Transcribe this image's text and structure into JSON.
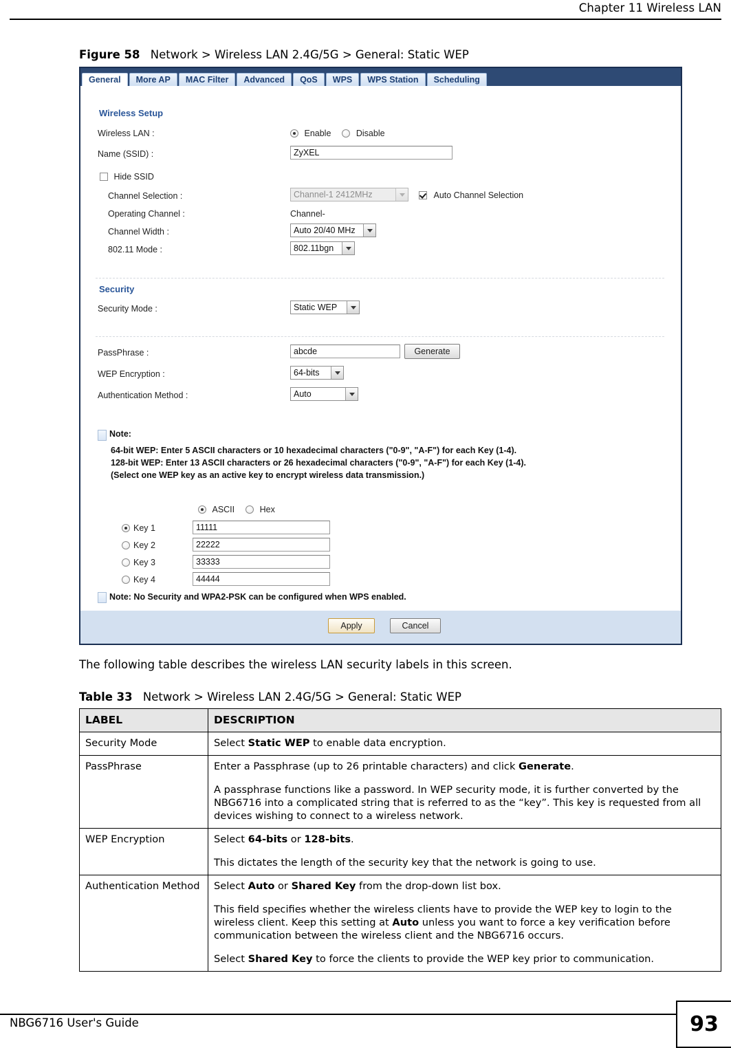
{
  "page": {
    "chapter_header": "Chapter 11 Wireless LAN",
    "footer_guide": "NBG6716 User's Guide",
    "page_number": "93"
  },
  "figure": {
    "label": "Figure 58",
    "title": "Network > Wireless LAN 2.4G/5G > General: Static WEP"
  },
  "screenshot": {
    "tabs": [
      {
        "label": "General",
        "active": true
      },
      {
        "label": "More AP",
        "active": false
      },
      {
        "label": "MAC Filter",
        "active": false
      },
      {
        "label": "Advanced",
        "active": false
      },
      {
        "label": "QoS",
        "active": false
      },
      {
        "label": "WPS",
        "active": false
      },
      {
        "label": "WPS Station",
        "active": false
      },
      {
        "label": "Scheduling",
        "active": false
      }
    ],
    "wireless_setup": {
      "section_title": "Wireless Setup",
      "wireless_lan_label": "Wireless LAN :",
      "enable_label": "Enable",
      "disable_label": "Disable",
      "ssid_label": "Name (SSID) :",
      "ssid_value": "ZyXEL",
      "hide_ssid_label": "Hide SSID",
      "channel_selection_label": "Channel Selection :",
      "channel_selection_value": "Channel-1 2412MHz",
      "auto_channel_label": "Auto Channel Selection",
      "operating_channel_label": "Operating Channel :",
      "operating_channel_value": "Channel-",
      "channel_width_label": "Channel Width :",
      "channel_width_value": "Auto 20/40 MHz",
      "mode_label": "802.11 Mode :",
      "mode_value": "802.11bgn"
    },
    "security": {
      "section_title": "Security",
      "security_mode_label": "Security Mode :",
      "security_mode_value": "Static WEP",
      "passphrase_label": "PassPhrase :",
      "passphrase_value": "abcde",
      "generate_button": "Generate",
      "wep_encryption_label": "WEP Encryption :",
      "wep_encryption_value": "64-bits",
      "auth_method_label": "Authentication Method :",
      "auth_method_value": "Auto"
    },
    "note": {
      "title": "Note:",
      "line1": "64-bit WEP: Enter 5 ASCII characters or 10 hexadecimal characters (\"0-9\", \"A-F\") for each Key (1-4).",
      "line2": "128-bit WEP: Enter 13 ASCII characters or 26 hexadecimal characters (\"0-9\", \"A-F\") for each Key (1-4).",
      "line3": "(Select one WEP key as an active key to encrypt wireless data transmission.)"
    },
    "keys": {
      "ascii_label": "ASCII",
      "hex_label": "Hex",
      "items": [
        {
          "label": "Key 1",
          "value": "11111",
          "selected": true
        },
        {
          "label": "Key 2",
          "value": "22222",
          "selected": false
        },
        {
          "label": "Key 3",
          "value": "33333",
          "selected": false
        },
        {
          "label": "Key 4",
          "value": "44444",
          "selected": false
        }
      ]
    },
    "wps_note": "Note: No Security and WPA2-PSK can be configured when WPS enabled.",
    "buttons": {
      "apply": "Apply",
      "cancel": "Cancel"
    }
  },
  "intro_paragraph": "The following table describes the wireless LAN security labels in this screen.",
  "table": {
    "caption_label": "Table 33",
    "caption_title": "Network > Wireless LAN 2.4G/5G > General: Static WEP",
    "headers": [
      "LABEL",
      "DESCRIPTION"
    ],
    "rows": [
      {
        "label": "Security Mode",
        "paras": [
          [
            {
              "t": "Select "
            },
            {
              "t": "Static WEP",
              "b": true
            },
            {
              "t": " to enable data encryption."
            }
          ]
        ]
      },
      {
        "label": "PassPhrase",
        "paras": [
          [
            {
              "t": "Enter a Passphrase (up to 26 printable characters) and click "
            },
            {
              "t": "Generate",
              "b": true
            },
            {
              "t": "."
            }
          ],
          [
            {
              "t": "A passphrase functions like a password. In WEP security mode, it is further converted by the NBG6716 into a complicated string that is referred to as the “key”. This key is requested from all devices wishing to connect to a wireless network."
            }
          ]
        ]
      },
      {
        "label": "WEP Encryption",
        "paras": [
          [
            {
              "t": "Select "
            },
            {
              "t": "64-bits",
              "b": true
            },
            {
              "t": " or "
            },
            {
              "t": "128-bits",
              "b": true
            },
            {
              "t": "."
            }
          ],
          [
            {
              "t": "This dictates the length of the security key that the network is going to use."
            }
          ]
        ]
      },
      {
        "label": "Authentication Method",
        "paras": [
          [
            {
              "t": "Select "
            },
            {
              "t": "Auto",
              "b": true
            },
            {
              "t": " or "
            },
            {
              "t": "Shared Key",
              "b": true
            },
            {
              "t": " from the drop-down list box."
            }
          ],
          [
            {
              "t": "This field specifies whether the wireless clients have to provide the WEP key to login to the wireless client. Keep this setting at "
            },
            {
              "t": "Auto",
              "b": true
            },
            {
              "t": " unless you want to force a key verification before communication between the wireless client and the NBG6716 occurs."
            }
          ],
          [
            {
              "t": "Select "
            },
            {
              "t": "Shared Key",
              "b": true
            },
            {
              "t": " to force the clients to provide the WEP key prior to communication."
            }
          ]
        ]
      }
    ]
  }
}
